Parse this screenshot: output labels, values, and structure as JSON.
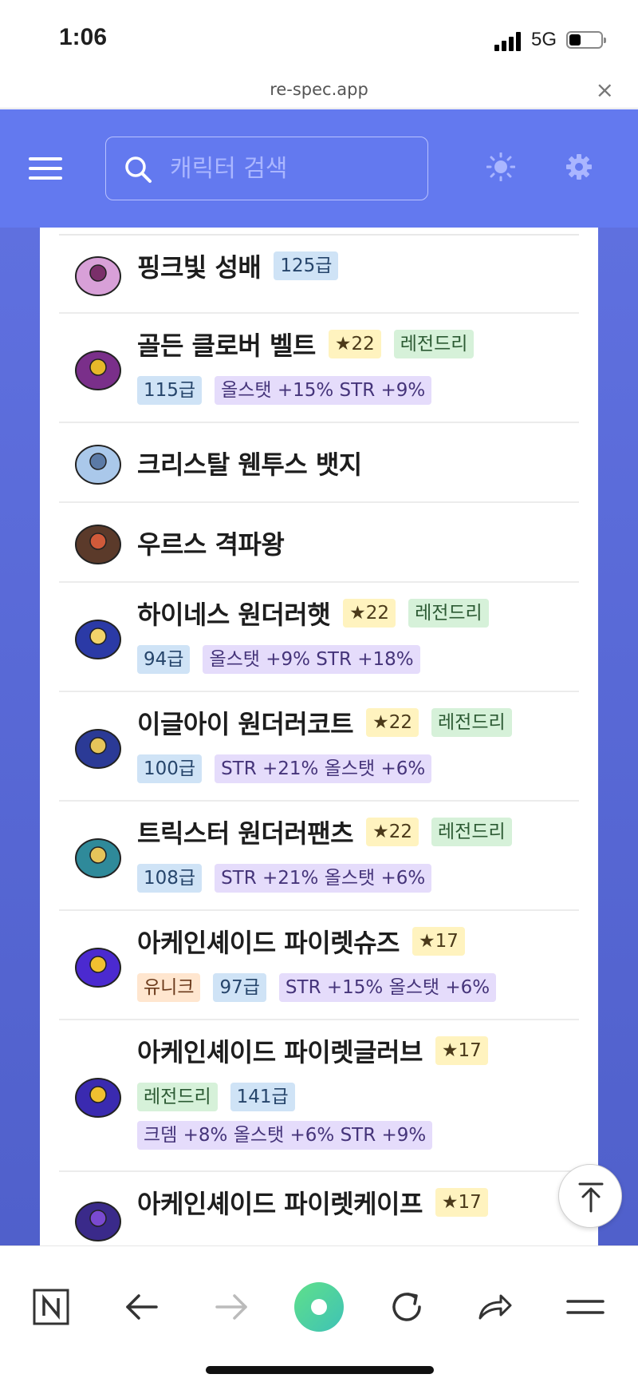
{
  "status_bar": {
    "time": "1:06",
    "network": "5G"
  },
  "browser": {
    "url": "re-spec.app",
    "close_glyph": "×"
  },
  "header": {
    "search_placeholder": "캐릭터 검색"
  },
  "items": [
    {
      "name": "핑크빛 성배",
      "icon": "pink-chalice-icon",
      "rows": [
        [
          {
            "type": "level",
            "text": "125급"
          }
        ]
      ]
    },
    {
      "name": "골든 클로버 벨트",
      "icon": "golden-clover-belt-icon",
      "rows": [
        [
          {
            "type": "star",
            "text": "★22"
          },
          {
            "type": "legend",
            "text": "레전드리"
          }
        ],
        [
          {
            "type": "level",
            "text": "115급"
          },
          {
            "type": "stat",
            "text": "올스탯 +15% STR +9%"
          }
        ]
      ]
    },
    {
      "name": "크리스탈 웬투스 뱃지",
      "icon": "crystal-badge-icon",
      "rows": []
    },
    {
      "name": "우르스 격파왕",
      "icon": "urus-medal-icon",
      "rows": []
    },
    {
      "name": "하이네스 원더러햇",
      "icon": "hat-icon",
      "rows": [
        [
          {
            "type": "star",
            "text": "★22"
          },
          {
            "type": "legend",
            "text": "레전드리"
          }
        ],
        [
          {
            "type": "level",
            "text": "94급"
          },
          {
            "type": "stat",
            "text": "올스탯 +9% STR +18%"
          }
        ]
      ]
    },
    {
      "name": "이글아이 원더러코트",
      "icon": "coat-icon",
      "rows": [
        [
          {
            "type": "star",
            "text": "★22"
          },
          {
            "type": "legend",
            "text": "레전드리"
          }
        ],
        [
          {
            "type": "level",
            "text": "100급"
          },
          {
            "type": "stat",
            "text": "STR +21% 올스탯 +6%"
          }
        ]
      ]
    },
    {
      "name": "트릭스터 원더러팬츠",
      "icon": "pants-icon",
      "rows": [
        [
          {
            "type": "star",
            "text": "★22"
          },
          {
            "type": "legend",
            "text": "레전드리"
          }
        ],
        [
          {
            "type": "level",
            "text": "108급"
          },
          {
            "type": "stat",
            "text": "STR +21% 올스탯 +6%"
          }
        ]
      ]
    },
    {
      "name": "아케인셰이드 파이렛슈즈",
      "icon": "shoes-icon",
      "rows": [
        [
          {
            "type": "star",
            "text": "★17"
          }
        ],
        [
          {
            "type": "unique",
            "text": "유니크"
          },
          {
            "type": "level",
            "text": "97급"
          },
          {
            "type": "stat",
            "text": "STR +15% 올스탯 +6%"
          }
        ]
      ]
    },
    {
      "name": "아케인셰이드 파이렛글러브",
      "icon": "glove-icon",
      "rows": [
        [
          {
            "type": "star",
            "text": "★17"
          }
        ],
        [
          {
            "type": "legend",
            "text": "레전드리"
          },
          {
            "type": "level",
            "text": "141급"
          }
        ],
        [
          {
            "type": "stat",
            "text": "크뎀 +8% 올스탯 +6% STR +9%"
          }
        ]
      ]
    },
    {
      "name": "아케인셰이드 파이렛케이프",
      "icon": "cape-icon",
      "rows": [
        [
          {
            "type": "star",
            "text": "★17"
          }
        ]
      ]
    }
  ]
}
